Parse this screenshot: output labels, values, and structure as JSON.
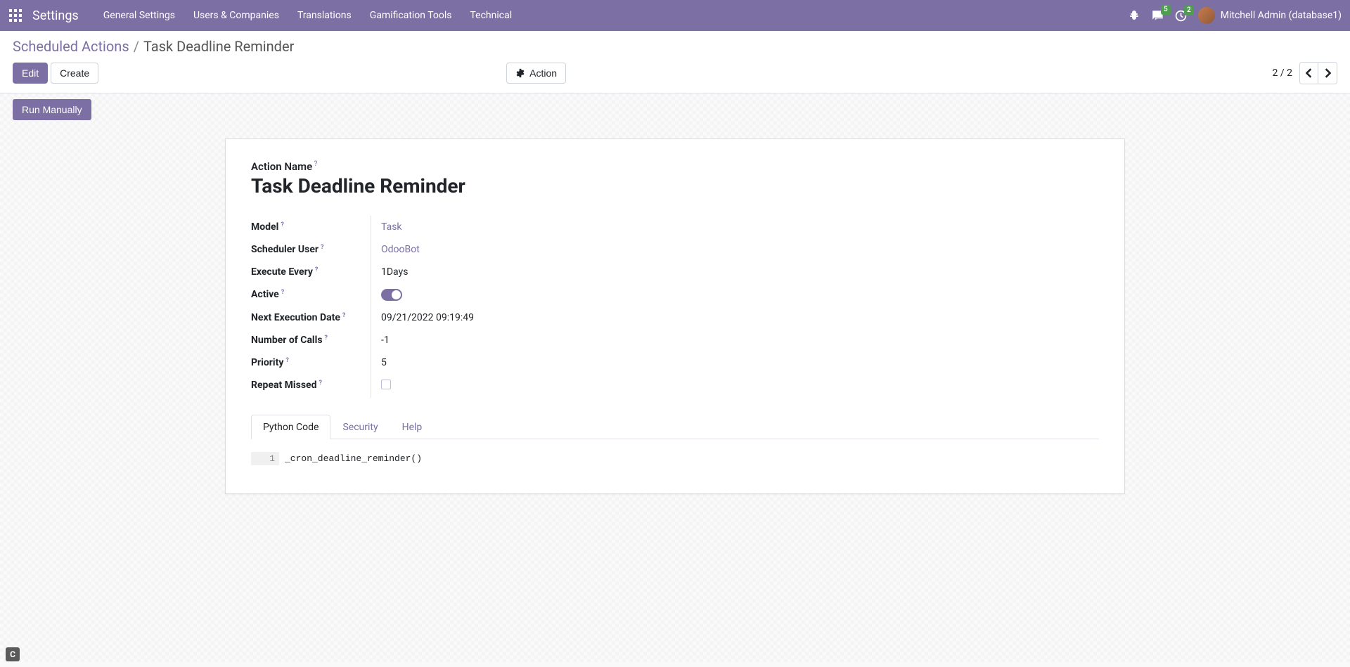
{
  "navbar": {
    "brand": "Settings",
    "menu": [
      "General Settings",
      "Users & Companies",
      "Translations",
      "Gamification Tools",
      "Technical"
    ],
    "messages_badge": "5",
    "activities_badge": "2",
    "username": "Mitchell Admin (database1)"
  },
  "breadcrumb": {
    "parent": "Scheduled Actions",
    "current": "Task Deadline Reminder"
  },
  "buttons": {
    "edit": "Edit",
    "create": "Create",
    "action": "Action",
    "run_manually": "Run Manually"
  },
  "pager": {
    "text": "2 / 2"
  },
  "form": {
    "action_name_label": "Action Name",
    "action_name_value": "Task Deadline Reminder",
    "fields": {
      "model": {
        "label": "Model",
        "value": "Task"
      },
      "scheduler_user": {
        "label": "Scheduler User",
        "value": "OdooBot"
      },
      "execute_every": {
        "label": "Execute Every",
        "value": "1Days"
      },
      "active": {
        "label": "Active"
      },
      "next_exec": {
        "label": "Next Execution Date",
        "value": "09/21/2022 09:19:49"
      },
      "num_calls": {
        "label": "Number of Calls",
        "value": "-1"
      },
      "priority": {
        "label": "Priority",
        "value": "5"
      },
      "repeat_missed": {
        "label": "Repeat Missed"
      }
    },
    "tabs": [
      "Python Code",
      "Security",
      "Help"
    ],
    "code": {
      "line_number": "1",
      "line": "_cron_deadline_reminder()"
    }
  },
  "corner": "C"
}
